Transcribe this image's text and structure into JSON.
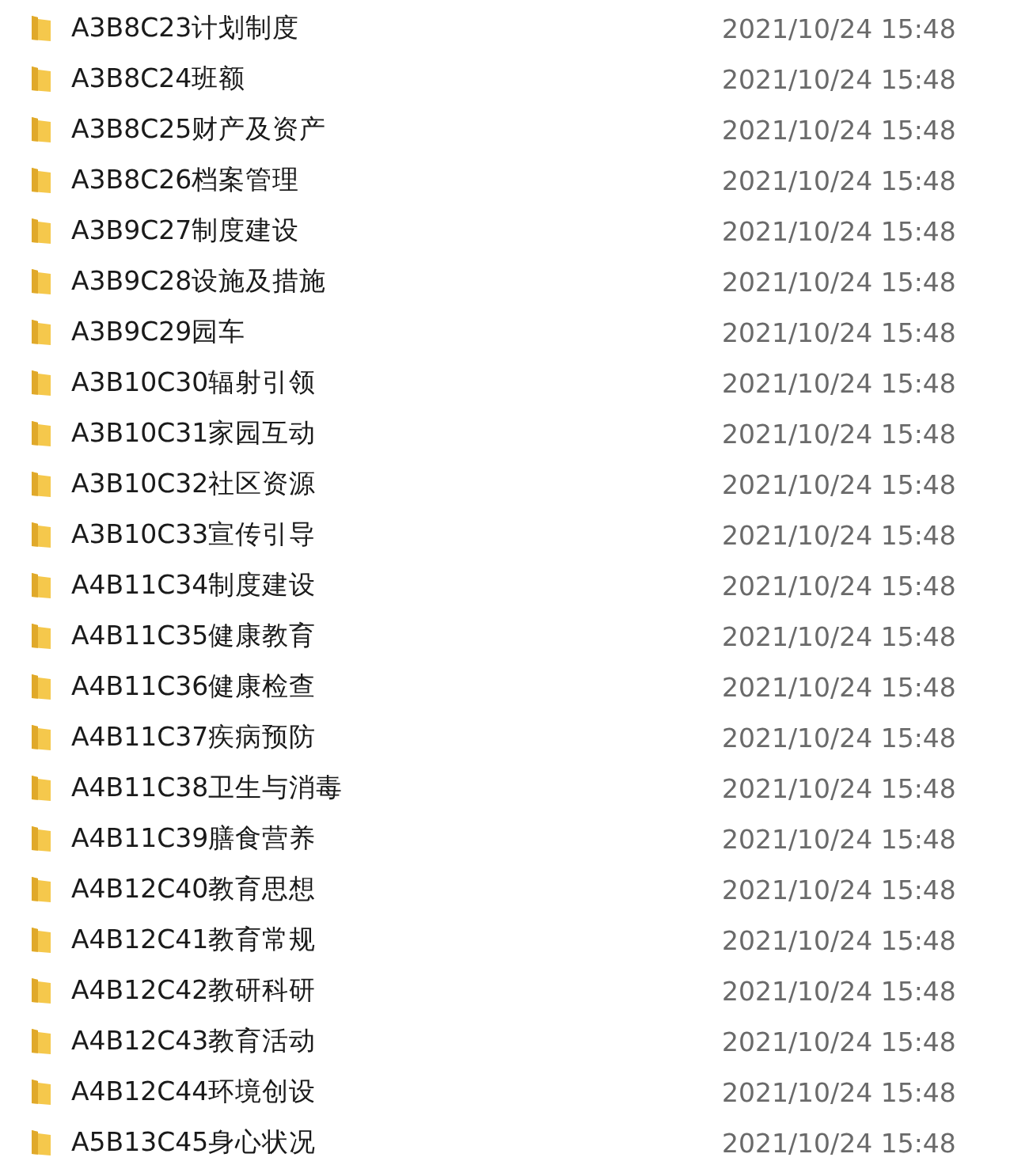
{
  "files": [
    {
      "name": "A3B8C23计划制度",
      "modified": "2021/10/24 15:48"
    },
    {
      "name": "A3B8C24班额",
      "modified": "2021/10/24 15:48"
    },
    {
      "name": "A3B8C25财产及资产",
      "modified": "2021/10/24 15:48"
    },
    {
      "name": "A3B8C26档案管理",
      "modified": "2021/10/24 15:48"
    },
    {
      "name": "A3B9C27制度建设",
      "modified": "2021/10/24 15:48"
    },
    {
      "name": "A3B9C28设施及措施",
      "modified": "2021/10/24 15:48"
    },
    {
      "name": "A3B9C29园车",
      "modified": "2021/10/24 15:48"
    },
    {
      "name": "A3B10C30辐射引领",
      "modified": "2021/10/24 15:48"
    },
    {
      "name": "A3B10C31家园互动",
      "modified": "2021/10/24 15:48"
    },
    {
      "name": "A3B10C32社区资源",
      "modified": "2021/10/24 15:48"
    },
    {
      "name": "A3B10C33宣传引导",
      "modified": "2021/10/24 15:48"
    },
    {
      "name": "A4B11C34制度建设",
      "modified": "2021/10/24 15:48"
    },
    {
      "name": "A4B11C35健康教育",
      "modified": "2021/10/24 15:48"
    },
    {
      "name": "A4B11C36健康检查",
      "modified": "2021/10/24 15:48"
    },
    {
      "name": "A4B11C37疾病预防",
      "modified": "2021/10/24 15:48"
    },
    {
      "name": "A4B11C38卫生与消毒",
      "modified": "2021/10/24 15:48"
    },
    {
      "name": "A4B11C39膳食营养",
      "modified": "2021/10/24 15:48"
    },
    {
      "name": "A4B12C40教育思想",
      "modified": "2021/10/24 15:48"
    },
    {
      "name": "A4B12C41教育常规",
      "modified": "2021/10/24 15:48"
    },
    {
      "name": "A4B12C42教研科研",
      "modified": "2021/10/24 15:48"
    },
    {
      "name": "A4B12C43教育活动",
      "modified": "2021/10/24 15:48"
    },
    {
      "name": "A4B12C44环境创设",
      "modified": "2021/10/24 15:48"
    },
    {
      "name": "A5B13C45身心状况",
      "modified": "2021/10/24 15:48"
    }
  ]
}
